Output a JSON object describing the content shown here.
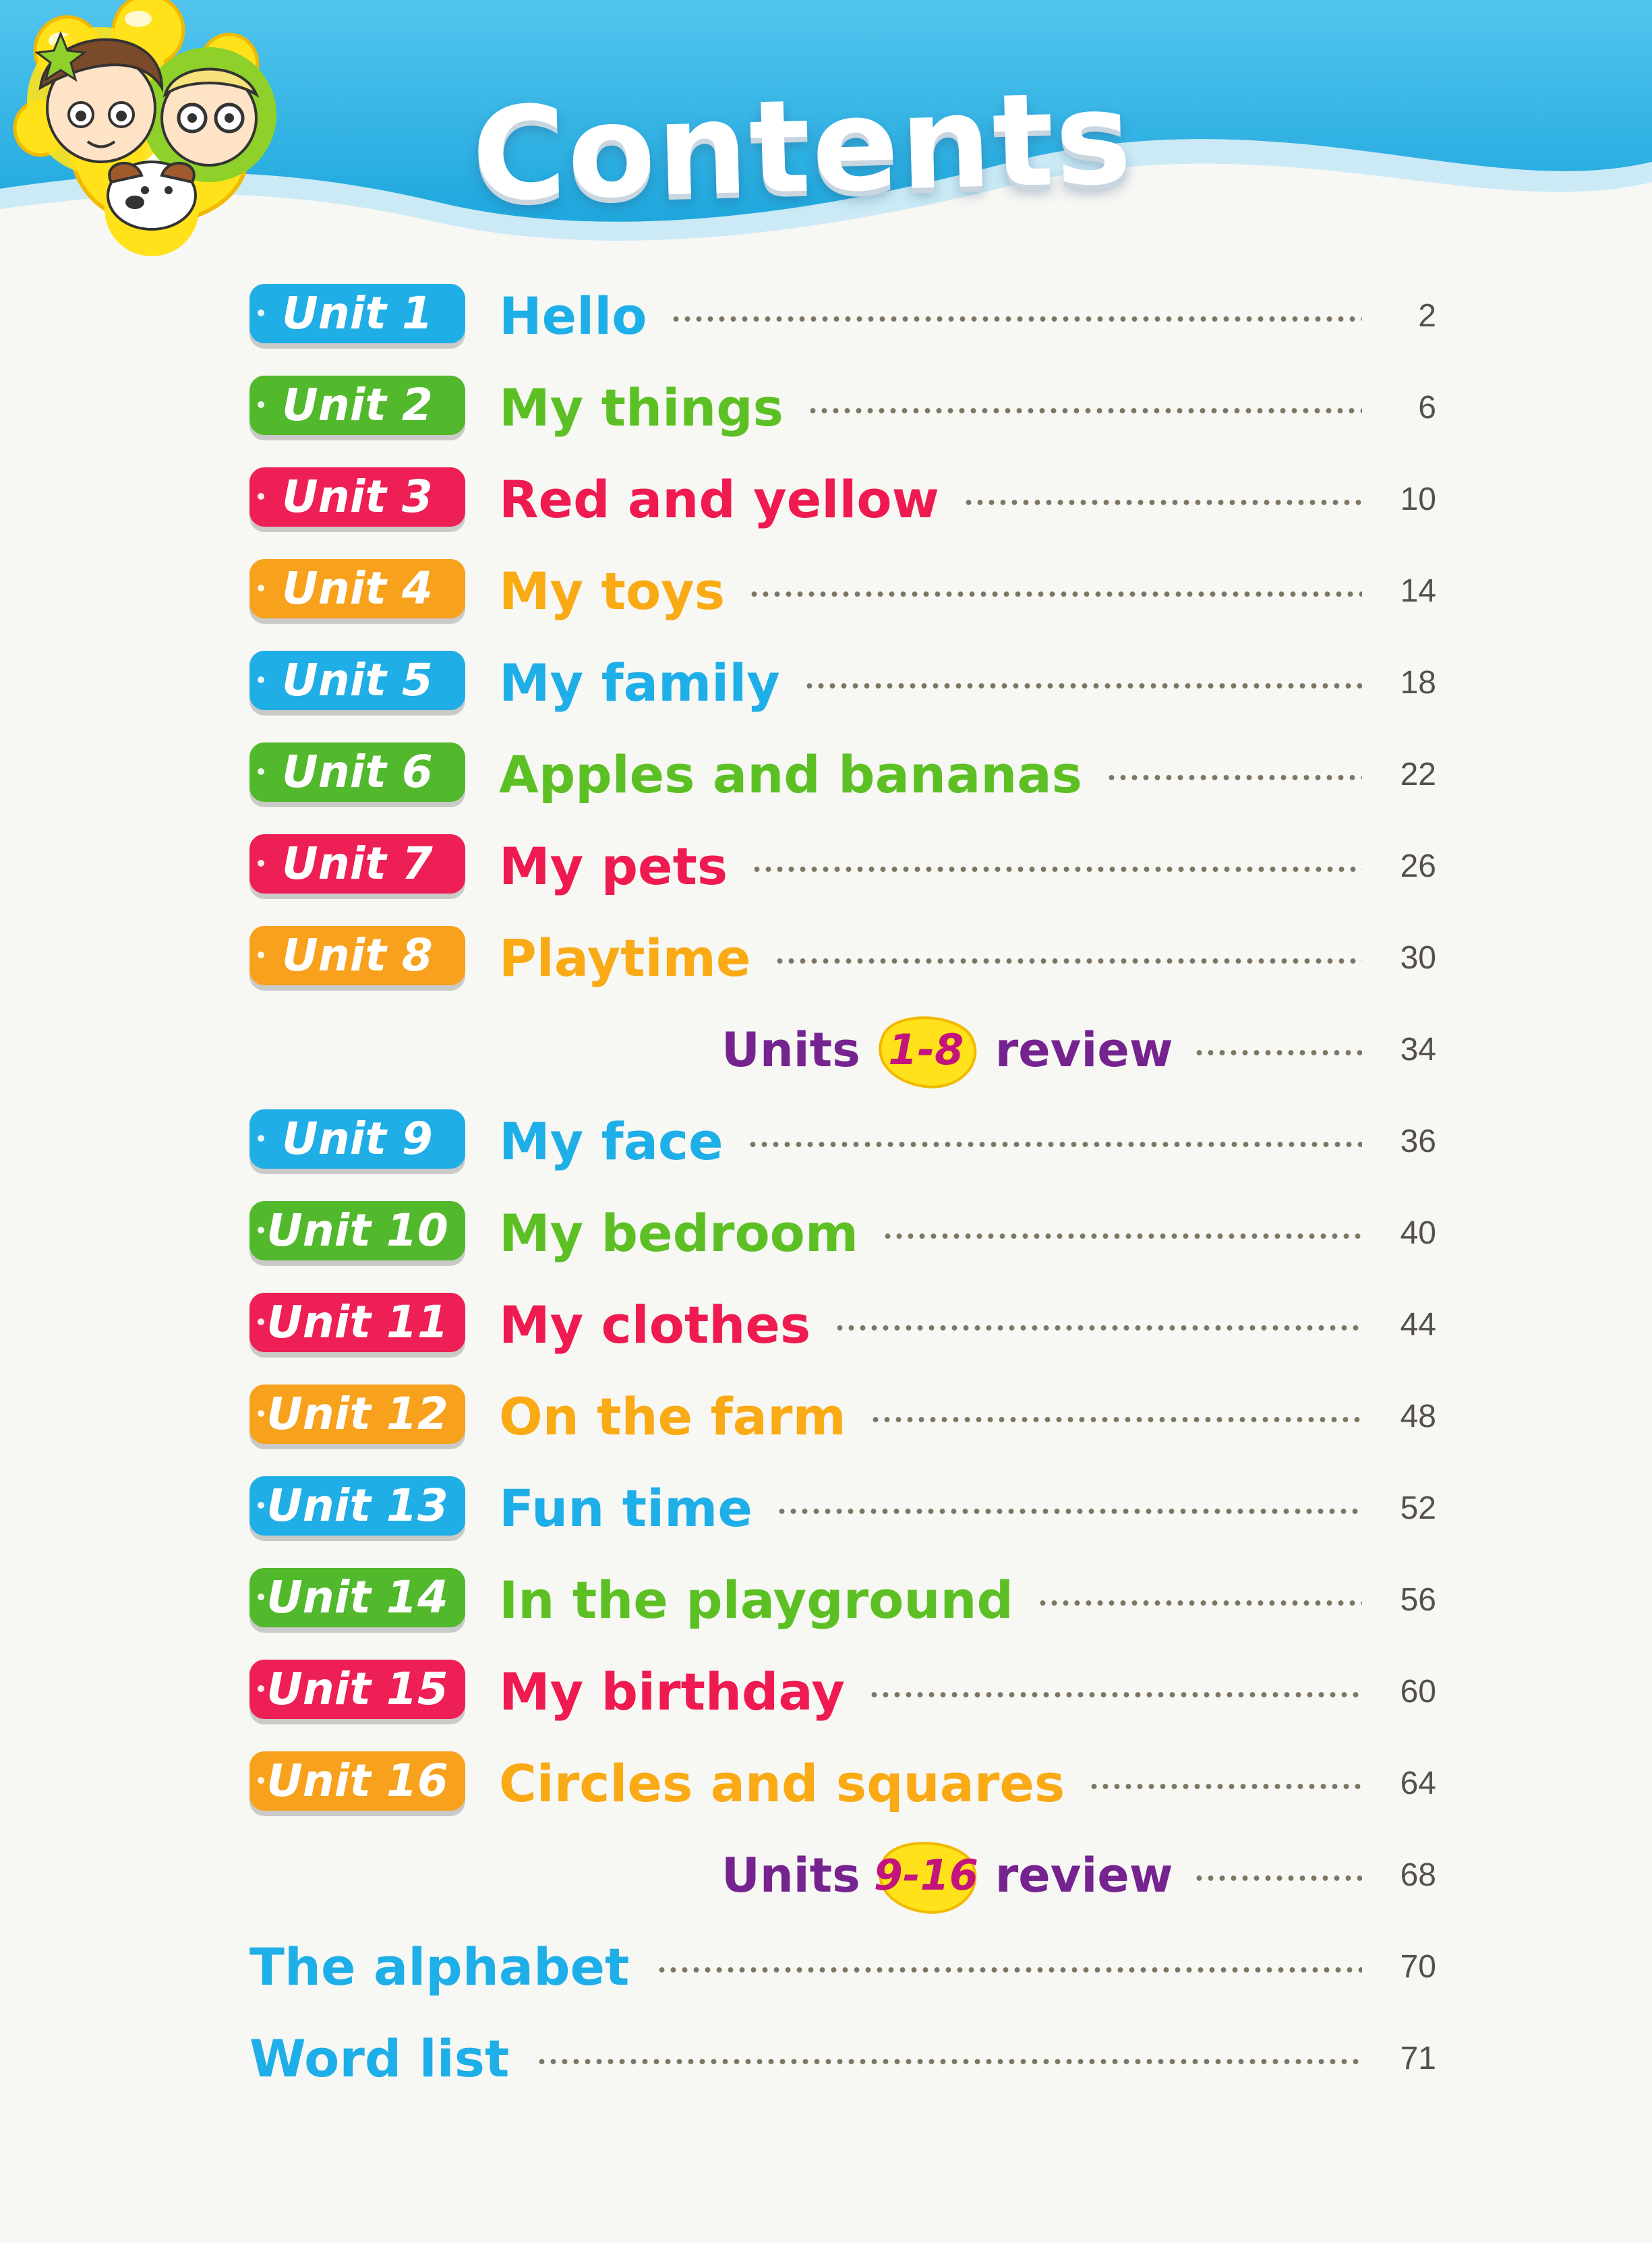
{
  "header": {
    "title": "Contents"
  },
  "units": [
    {
      "badge": "Unit 1",
      "title": "Hello",
      "page": "2",
      "color": "#20aee6"
    },
    {
      "badge": "Unit 2",
      "title": "My things",
      "page": "6",
      "color": "#52b82c"
    },
    {
      "badge": "Unit 3",
      "title": "Red and yellow",
      "page": "10",
      "color": "#ee1f54"
    },
    {
      "badge": "Unit 4",
      "title": "My toys",
      "page": "14",
      "color": "#f7a11d"
    },
    {
      "badge": "Unit 5",
      "title": "My family",
      "page": "18",
      "color": "#20aee6"
    },
    {
      "badge": "Unit 6",
      "title": "Apples and bananas",
      "page": "22",
      "color": "#52b82c"
    },
    {
      "badge": "Unit 7",
      "title": "My pets",
      "page": "26",
      "color": "#ee1f54"
    },
    {
      "badge": "Unit 8",
      "title": "Playtime",
      "page": "30",
      "color": "#f7a11d"
    },
    {
      "badge": "Unit 9",
      "title": "My face",
      "page": "36",
      "color": "#20aee6"
    },
    {
      "badge": "Unit 10",
      "title": "My bedroom",
      "page": "40",
      "color": "#52b82c"
    },
    {
      "badge": "Unit 11",
      "title": "My clothes",
      "page": "44",
      "color": "#ee1f54"
    },
    {
      "badge": "Unit 12",
      "title": "On the farm",
      "page": "48",
      "color": "#f7a11d"
    },
    {
      "badge": "Unit 13",
      "title": "Fun time",
      "page": "52",
      "color": "#20aee6"
    },
    {
      "badge": "Unit 14",
      "title": "In the playground",
      "page": "56",
      "color": "#52b82c"
    },
    {
      "badge": "Unit 15",
      "title": "My birthday",
      "page": "60",
      "color": "#ee1f54"
    },
    {
      "badge": "Unit 16",
      "title": "Circles and squares",
      "page": "64",
      "color": "#f7a11d"
    }
  ],
  "reviews": [
    {
      "word1": "Units",
      "range": "1-8",
      "word2": "review",
      "page": "34"
    },
    {
      "word1": "Units",
      "range": "9-16",
      "word2": "review",
      "page": "68"
    }
  ],
  "extras": [
    {
      "title": "The alphabet",
      "page": "70"
    },
    {
      "title": "Word list",
      "page": "71"
    }
  ]
}
